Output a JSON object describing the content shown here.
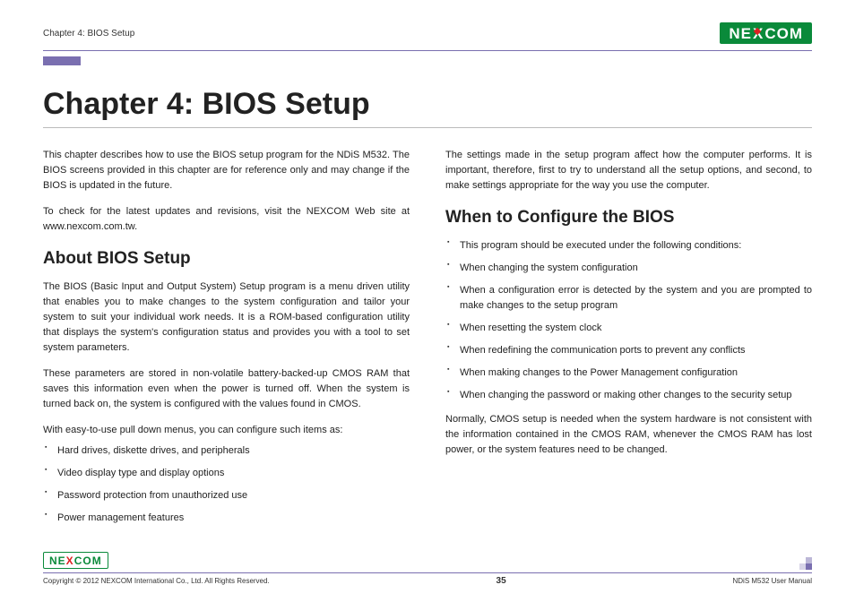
{
  "header": {
    "chapter_label": "Chapter 4: BIOS Setup",
    "logo_pre": "NE",
    "logo_x": "X",
    "logo_post": "COM"
  },
  "title": "Chapter 4: BIOS Setup",
  "left": {
    "intro1": "This chapter describes how to use the BIOS setup program for the NDiS M532. The BIOS screens provided in this chapter are for reference only and may change if the BIOS is updated in the future.",
    "intro2": "To check for the latest updates and revisions, visit the NEXCOM Web site at www.nexcom.com.tw.",
    "h_about": "About BIOS Setup",
    "about1": "The BIOS (Basic Input and Output System) Setup program is a menu driven utility that enables you to make changes to the system configuration and tailor your system to suit your individual work needs. It is a ROM-based configuration utility that displays the system's configuration status and provides you with a tool to set system parameters.",
    "about2": "These parameters are stored in non-volatile battery-backed-up CMOS RAM that saves this information even when the power is turned off. When the system is turned back on, the system is configured with the values found in CMOS.",
    "about3": "With easy-to-use pull down menus, you can configure such items as:",
    "items": [
      "Hard drives, diskette drives, and peripherals",
      "Video display type and display options",
      "Password protection from unauthorized use",
      "Power management features"
    ]
  },
  "right": {
    "top": "The settings made in the setup program affect how the computer performs. It is important, therefore, first to try to understand all the setup options, and second, to make settings appropriate for the way you use the computer.",
    "h_when": "When to Configure the BIOS",
    "conds": [
      "This program should be executed under the following conditions:",
      "When changing the system configuration",
      "When a configuration error is detected by the system and you are prompted to make changes to the setup program",
      "When resetting the system clock",
      "When redefining the communication ports to prevent any conflicts",
      "When making changes to the Power Management configuration",
      "When changing the password or making other changes to the security setup"
    ],
    "after": "Normally, CMOS setup is needed when the system hardware is not consistent with the information contained in the CMOS RAM, whenever the CMOS RAM has lost power, or the system features need to be changed."
  },
  "footer": {
    "logo_pre": "NE",
    "logo_x": "X",
    "logo_post": "COM",
    "copyright": "Copyright © 2012 NEXCOM International Co., Ltd. All Rights Reserved.",
    "page": "35",
    "manual": "NDiS M532 User Manual"
  }
}
